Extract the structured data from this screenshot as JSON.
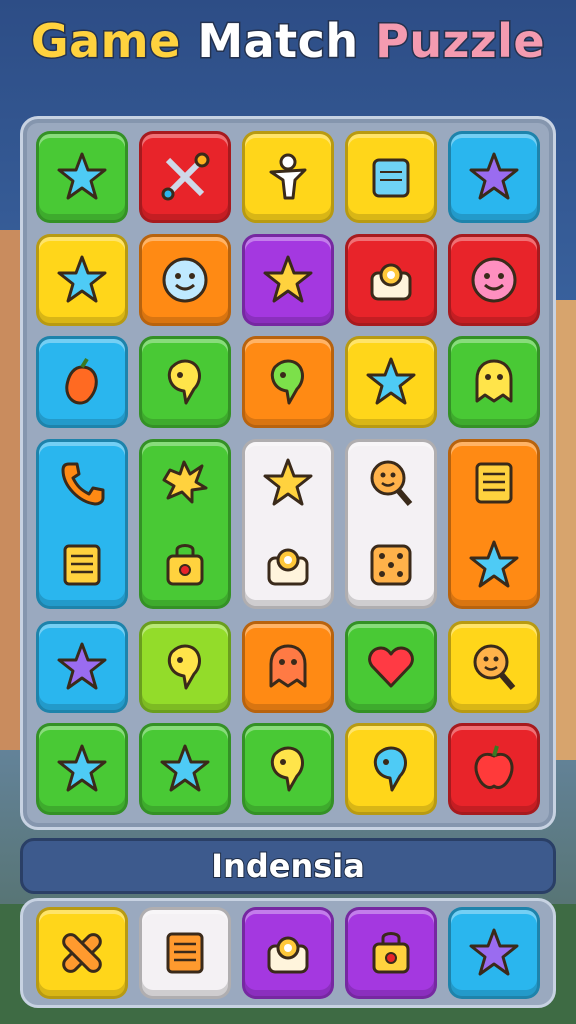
{
  "title": {
    "word1": "Game",
    "word2": "Match",
    "word3": "Puzzle"
  },
  "colors": {
    "green": "#49c935",
    "red": "#e8242a",
    "yellow": "#ffd61a",
    "blue": "#2ab6ee",
    "orange": "#ff8a14",
    "purple": "#a438e0",
    "lime": "#93dc2a",
    "white": "#f4f1f4"
  },
  "board": {
    "rows": [
      [
        {
          "color": "green",
          "icon": "star-icon"
        },
        {
          "color": "red",
          "icon": "crossed-tools-icon"
        },
        {
          "color": "yellow",
          "icon": "figure-icon"
        },
        {
          "color": "yellow",
          "icon": "notebook-icon"
        },
        {
          "color": "blue",
          "icon": "star-icon"
        }
      ],
      [
        {
          "color": "yellow",
          "icon": "star-icon"
        },
        {
          "color": "orange",
          "icon": "smiley-face-icon"
        },
        {
          "color": "purple",
          "icon": "star-icon"
        },
        {
          "color": "red",
          "icon": "gadget-icon"
        },
        {
          "color": "red",
          "icon": "smiley-face-icon"
        }
      ],
      [
        {
          "color": "blue",
          "icon": "fruit-icon"
        },
        {
          "color": "green",
          "icon": "balloon-icon"
        },
        {
          "color": "orange",
          "icon": "balloon-icon"
        },
        {
          "color": "yellow",
          "icon": "star-icon"
        },
        {
          "color": "green",
          "icon": "ghost-icon"
        }
      ],
      [
        {
          "color": "blue",
          "icons": [
            "phone-icon",
            "note-icon"
          ]
        },
        {
          "color": "green",
          "icons": [
            "splat-icon",
            "bag-icon"
          ]
        },
        {
          "color": "white",
          "icons": [
            "star-icon",
            "gadget-icon"
          ]
        },
        {
          "color": "white",
          "icons": [
            "magnifier-face-icon",
            "dice-icon"
          ]
        },
        {
          "color": "orange",
          "icons": [
            "note-icon",
            "star-icon"
          ]
        }
      ],
      [
        {
          "color": "blue",
          "icon": "star-icon"
        },
        {
          "color": "lime",
          "icon": "balloon-icon"
        },
        {
          "color": "orange",
          "icon": "ghost-icon"
        },
        {
          "color": "green",
          "icon": "heart-icon"
        },
        {
          "color": "yellow",
          "icon": "magnifier-face-icon"
        }
      ],
      [
        {
          "color": "green",
          "icon": "star-icon"
        },
        {
          "color": "green",
          "icon": "star-icon"
        },
        {
          "color": "green",
          "icon": "balloon-icon"
        },
        {
          "color": "yellow",
          "icon": "balloon-icon"
        },
        {
          "color": "red",
          "icon": "apple-icon"
        }
      ]
    ]
  },
  "label": "Indensia",
  "tray": [
    {
      "color": "yellow",
      "icon": "crossed-bread-icon"
    },
    {
      "color": "white",
      "icon": "note-icon"
    },
    {
      "color": "purple",
      "icon": "gadget-icon"
    },
    {
      "color": "purple",
      "icon": "bag-icon"
    },
    {
      "color": "blue",
      "icon": "star-icon"
    }
  ]
}
